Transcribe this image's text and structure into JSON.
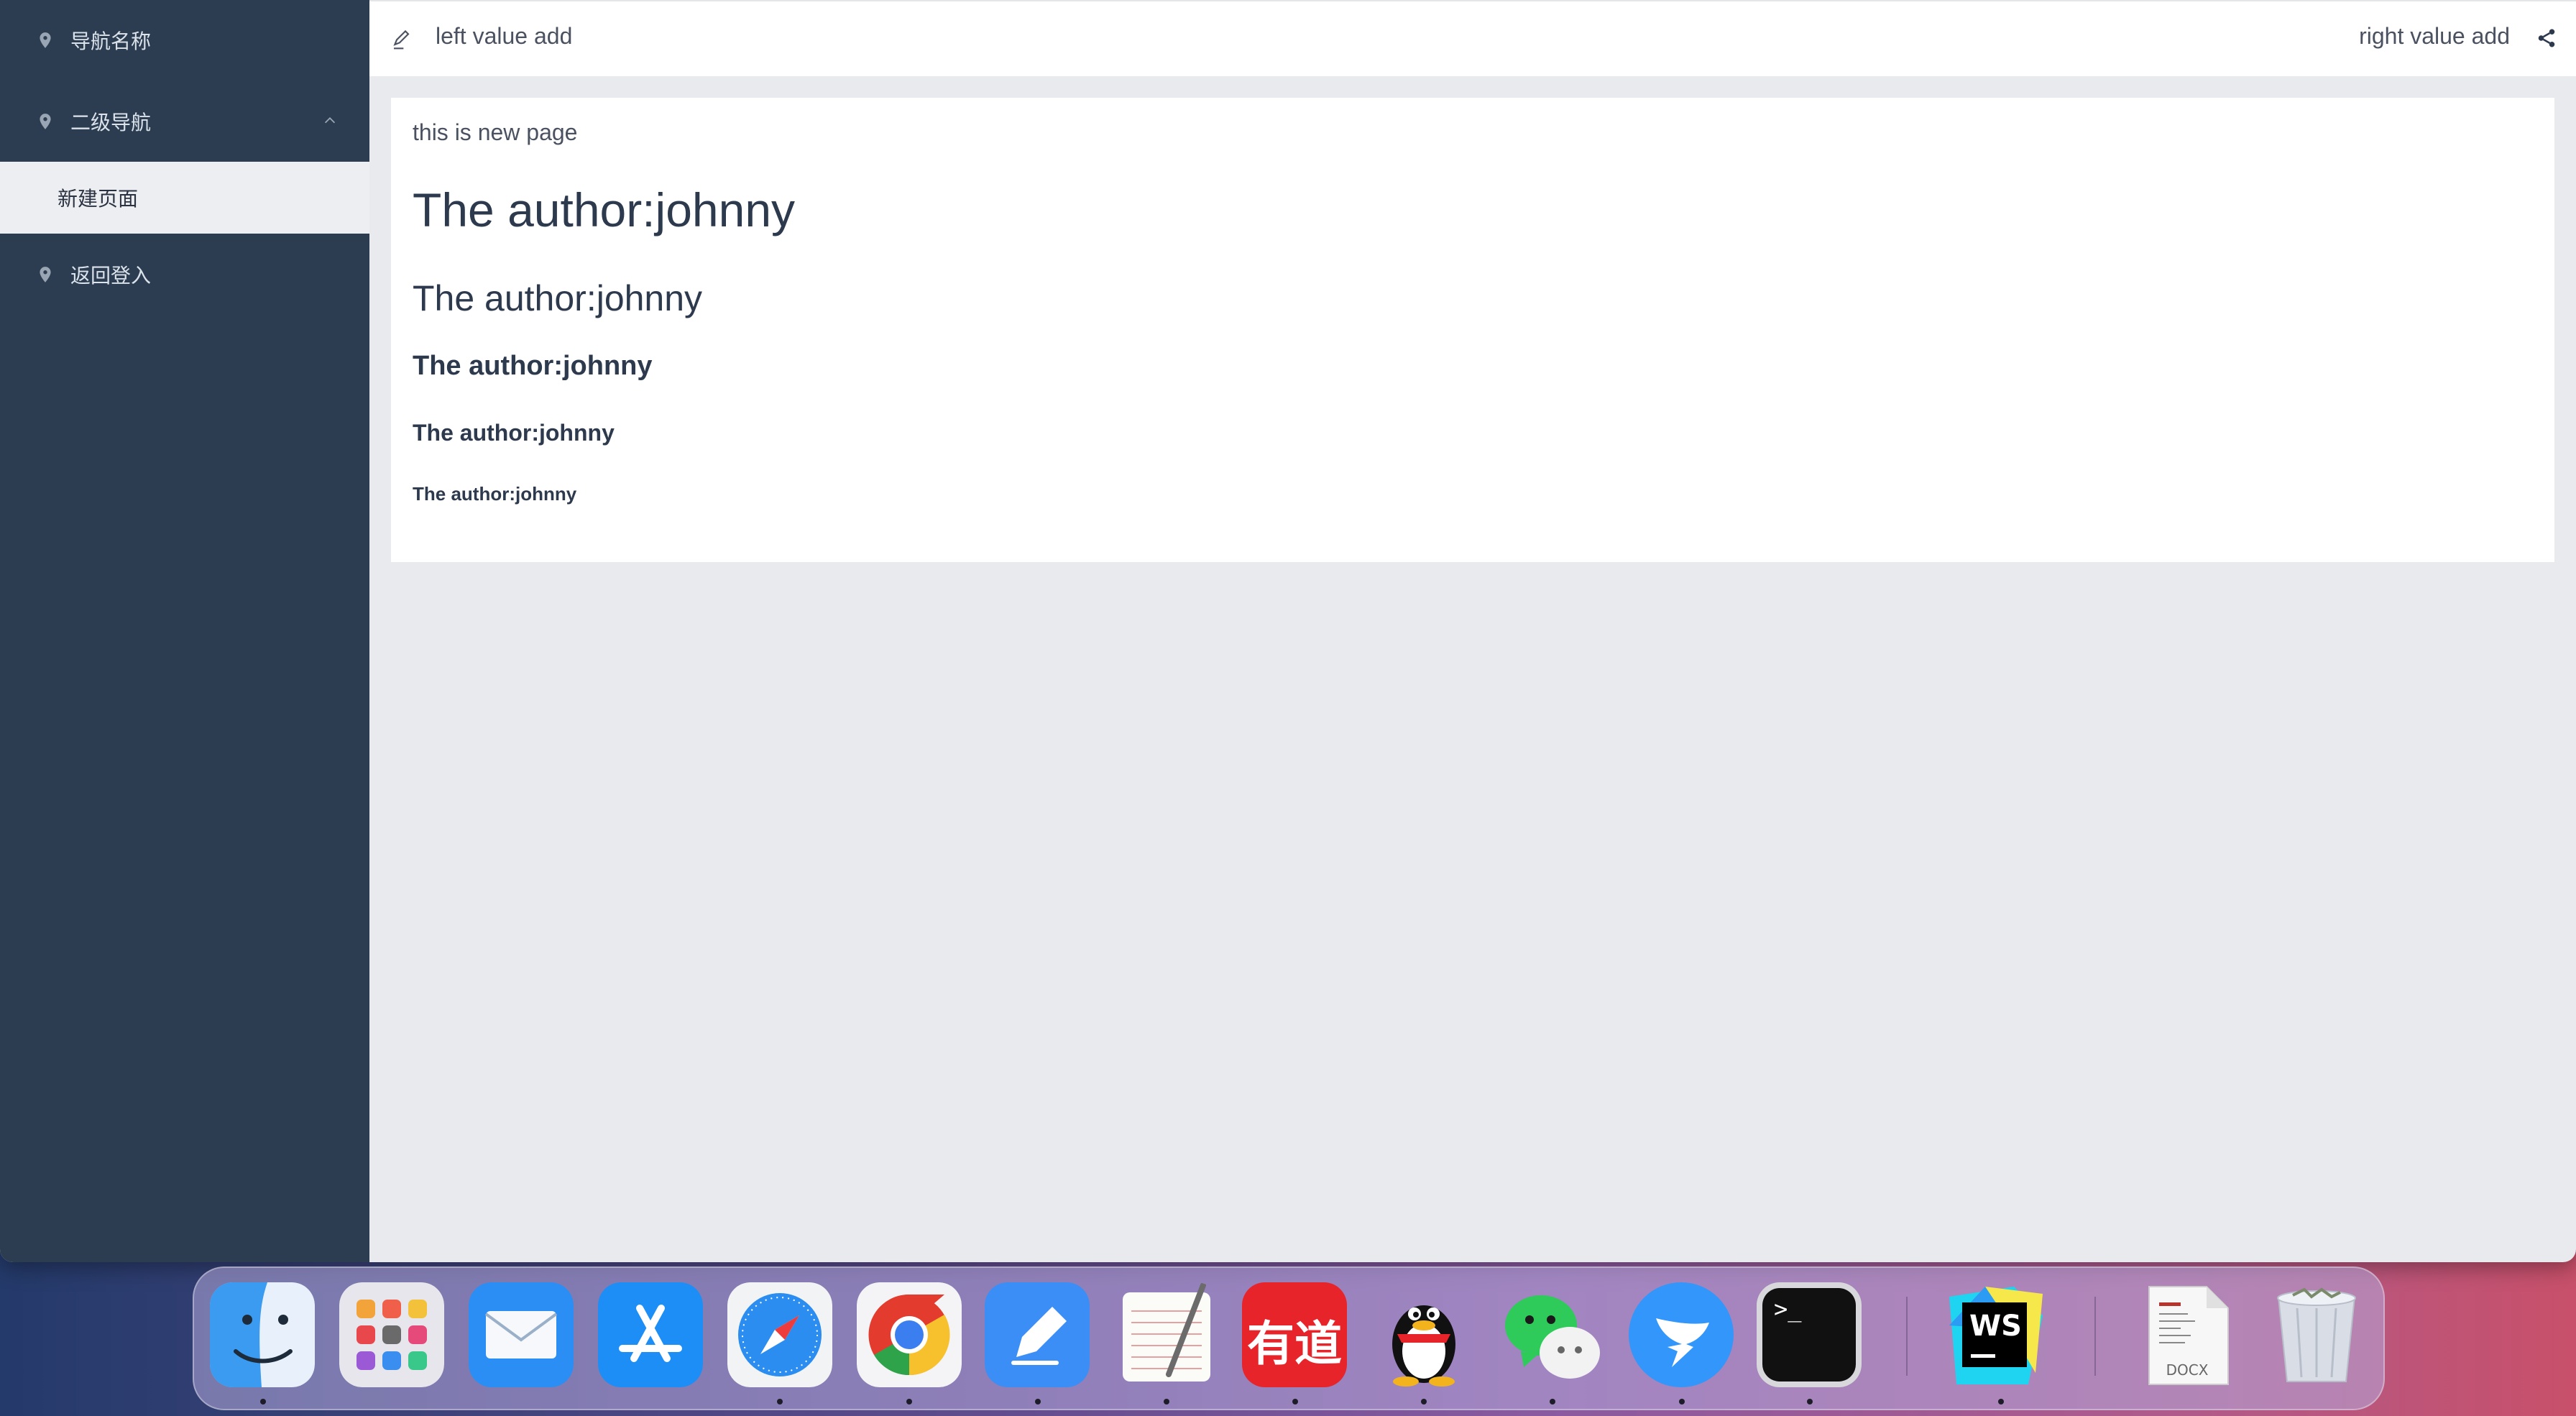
{
  "sidebar": {
    "items": [
      {
        "label": "导航名称"
      },
      {
        "label": "二级导航"
      },
      {
        "label": "新建页面"
      },
      {
        "label": "返回登入"
      }
    ]
  },
  "header": {
    "left_text": "left value add",
    "right_text": "right value add"
  },
  "content": {
    "intro": "this is new page",
    "headings": [
      "The author:johnny",
      "The author:johnny",
      "The author:johnny",
      "The author:johnny",
      "The author:johnny"
    ]
  },
  "dock": {
    "apps": [
      {
        "name": "Finder",
        "icon": "finder-icon"
      },
      {
        "name": "Launchpad",
        "icon": "launchpad-icon"
      },
      {
        "name": "Mail",
        "icon": "mail-icon"
      },
      {
        "name": "App Store",
        "icon": "app-store-icon"
      },
      {
        "name": "Safari",
        "icon": "safari-icon"
      },
      {
        "name": "Chrome",
        "icon": "chrome-icon"
      },
      {
        "name": "Notes Editor",
        "icon": "pen-app-icon"
      },
      {
        "name": "TextEdit",
        "icon": "textedit-icon"
      },
      {
        "name": "有道",
        "icon": "youdao-icon"
      },
      {
        "name": "QQ",
        "icon": "qq-icon"
      },
      {
        "name": "WeChat",
        "icon": "wechat-icon"
      },
      {
        "name": "DingTalk",
        "icon": "dingtalk-icon"
      },
      {
        "name": "Terminal",
        "icon": "terminal-icon"
      },
      {
        "name": "WebStorm",
        "icon": "webstorm-icon"
      },
      {
        "name": "DOCX",
        "icon": "docx-file-icon"
      },
      {
        "name": "Trash",
        "icon": "trash-icon"
      }
    ],
    "youdao_text": "有道",
    "webstorm_text": "WS",
    "terminal_prompt": ">_",
    "docx_label": "DOCX"
  },
  "colors": {
    "sidebar_bg": "#2c3d52",
    "content_bg": "#e8eaee",
    "heading_text": "#2d3a4e"
  }
}
